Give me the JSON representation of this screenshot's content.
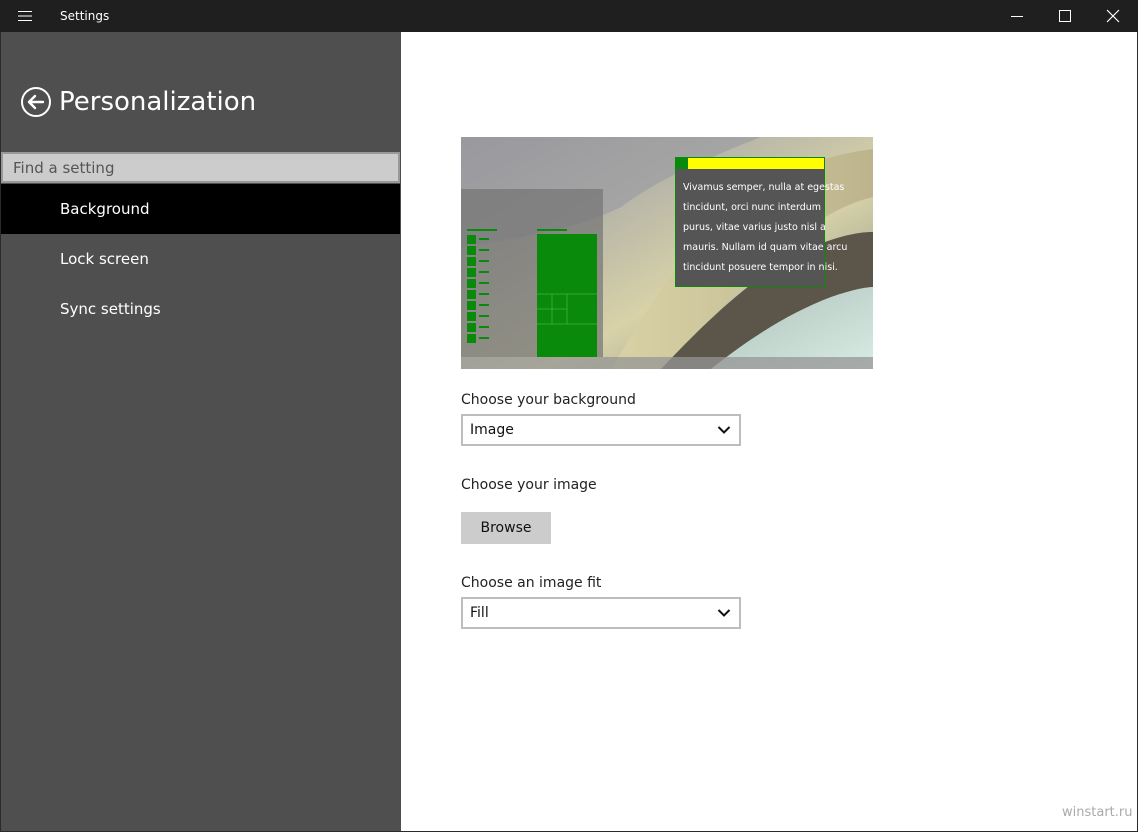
{
  "titlebar": {
    "app_title": "Settings",
    "menu_icon": "hamburger-icon",
    "minimize_icon": "minimize-icon",
    "maximize_icon": "maximize-icon",
    "close_icon": "close-icon"
  },
  "sidebar": {
    "back_icon": "back-arrow-icon",
    "page_title": "Personalization",
    "search_placeholder": "Find a setting",
    "items": [
      {
        "label": "Background",
        "selected": true
      },
      {
        "label": "Lock screen",
        "selected": false
      },
      {
        "label": "Sync settings",
        "selected": false
      }
    ]
  },
  "preview": {
    "sample_text_lines": [
      "Vivamus semper, nulla at egestas",
      "tincidunt, orci nunc interdum",
      "purus, vitae varius justo nisl a",
      "mauris. Nullam id quam vitae arcu",
      "tincidunt posuere tempor in nisi."
    ],
    "accent_color": "#0a8a0a",
    "highlight_color": "#ffff00"
  },
  "main": {
    "background_label": "Choose your background",
    "background_value": "Image",
    "image_label": "Choose your image",
    "browse_label": "Browse",
    "fit_label": "Choose an image fit",
    "fit_value": "Fill",
    "dropdown_icon": "chevron-down-icon"
  },
  "watermark": "winstart.ru"
}
